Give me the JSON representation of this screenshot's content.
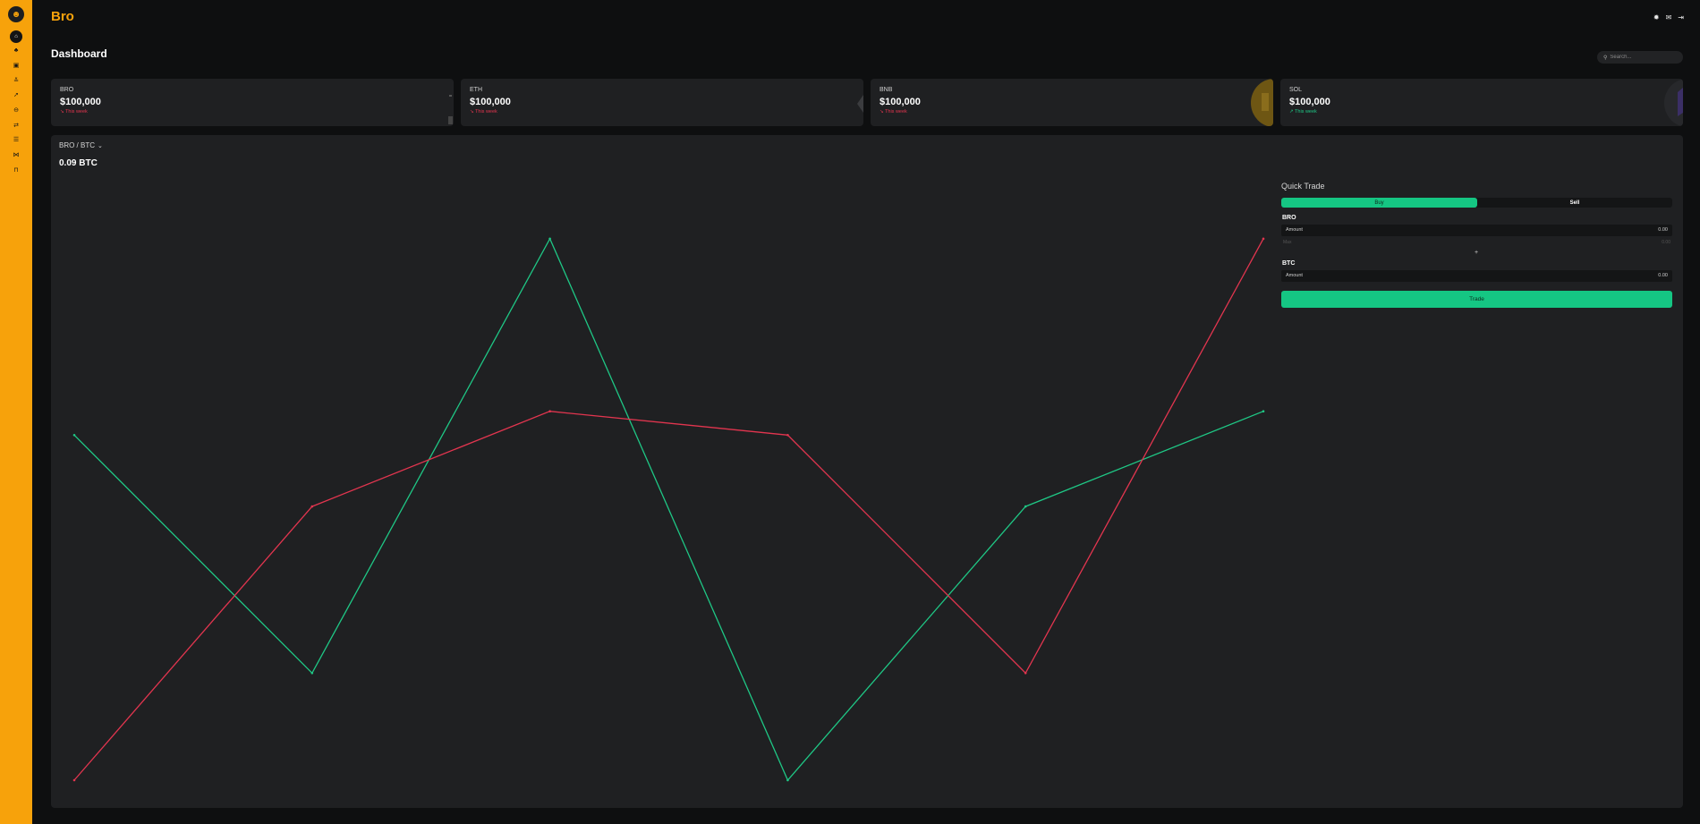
{
  "app": {
    "brand": "Bro"
  },
  "colors": {
    "brand": "#f7a20b",
    "up": "#1fc785",
    "down": "#e2354f",
    "accent": "#15c683"
  },
  "sidebar": {
    "items": [
      {
        "icon": "home-icon",
        "active": true
      },
      {
        "icon": "users-icon"
      },
      {
        "icon": "wallet-icon"
      },
      {
        "icon": "sort-icon"
      },
      {
        "icon": "rocket-icon"
      },
      {
        "icon": "gamepad-icon"
      },
      {
        "icon": "exchange-icon"
      },
      {
        "icon": "list-icon"
      },
      {
        "icon": "handshake-icon"
      },
      {
        "icon": "trash-icon"
      }
    ]
  },
  "header": {
    "icons": [
      "settings-icon",
      "mail-icon",
      "logout-icon"
    ]
  },
  "page": {
    "title": "Dashboard"
  },
  "search": {
    "placeholder": "Search..."
  },
  "cards": [
    {
      "symbol": "BRO",
      "price": "$100,000",
      "change": "↘ This week",
      "trend": "down"
    },
    {
      "symbol": "ETH",
      "price": "$100,000",
      "change": "↘ This week",
      "trend": "down"
    },
    {
      "symbol": "BNB",
      "price": "$100,000",
      "change": "↘ This week",
      "trend": "down"
    },
    {
      "symbol": "SOL",
      "price": "$100,000",
      "change": "↗ This week",
      "trend": "up"
    }
  ],
  "main": {
    "pair": "BRO / BTC",
    "price": "0.09 BTC"
  },
  "quick_trade": {
    "title": "Quick Trade",
    "buy_label": "Buy",
    "sell_label": "Sell",
    "from": {
      "label": "BRO",
      "placeholder": "Amount",
      "value": "0.00",
      "max_label": "Max",
      "max_value": "0.00"
    },
    "swap_icon": "+",
    "to": {
      "label": "BTC",
      "placeholder": "Amount",
      "value": "0.00"
    },
    "trade_label": "Trade"
  },
  "chart_data": {
    "type": "line",
    "ylim": [
      0,
      10
    ],
    "grid": false,
    "series": [
      {
        "values": [
          5.8,
          1.8,
          9.1,
          0,
          4.6,
          6.2
        ],
        "color": "#1fc785"
      },
      {
        "values": [
          0,
          4.6,
          6.2,
          5.8,
          1.8,
          9.1
        ],
        "color": "#e2354f"
      }
    ]
  }
}
